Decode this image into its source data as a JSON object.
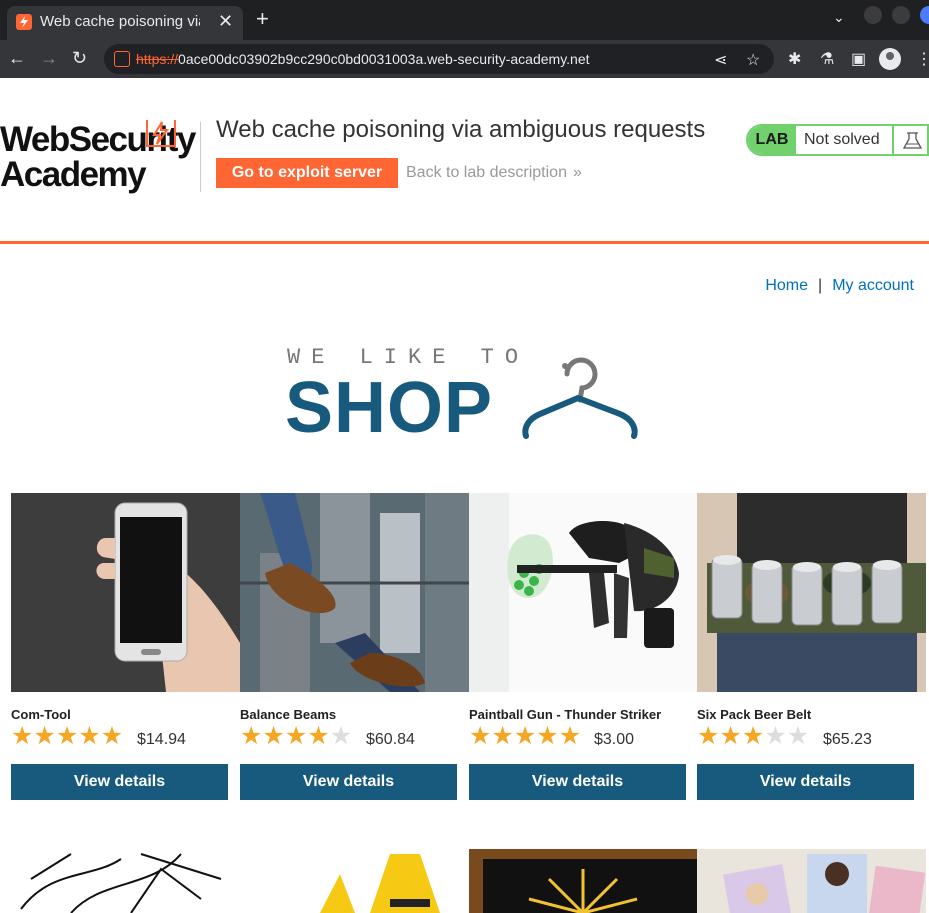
{
  "browser": {
    "tab_title": "Web cache poisoning via ambiguous requests",
    "url_scheme": "https://",
    "url_host": "0ace00dc03902b9cc290c0bd0031003a.web-security-academy.net"
  },
  "academy": {
    "logo_line1": "WebSecurity",
    "logo_line2": "Academy",
    "lab_title": "Web cache poisoning via ambiguous requests",
    "exploit_button": "Go to exploit server",
    "back_link": "Back to lab description",
    "lab_badge": "LAB",
    "lab_status": "Not solved",
    "accent_color": "#ff6633",
    "status_color": "#70d16d"
  },
  "nav": {
    "home": "Home",
    "separator": "|",
    "account": "My account"
  },
  "banner": {
    "tagline": "WE LIKE TO",
    "headline": "SHOP"
  },
  "products": [
    {
      "name": "Com-Tool",
      "rating": 5,
      "price": "$14.94",
      "button": "View details"
    },
    {
      "name": "Balance Beams",
      "rating": 4,
      "price": "$60.84",
      "button": "View details"
    },
    {
      "name": "Paintball Gun - Thunder Striker",
      "rating": 5,
      "price": "$3.00",
      "button": "View details"
    },
    {
      "name": "Six Pack Beer Belt",
      "rating": 3,
      "price": "$65.23",
      "button": "View details"
    }
  ]
}
